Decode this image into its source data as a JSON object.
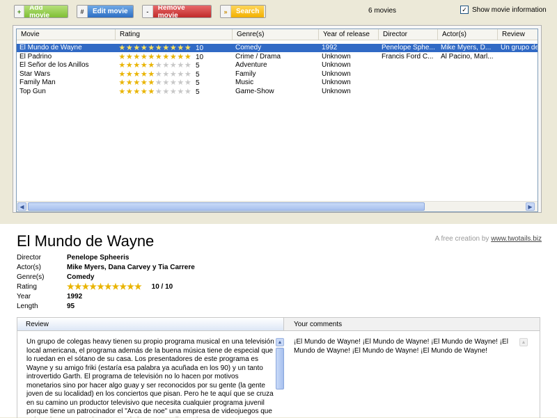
{
  "toolbar": {
    "add": {
      "icon": "+",
      "label": "Add movie"
    },
    "edit": {
      "icon": "#",
      "label": "Edit movie"
    },
    "remove": {
      "icon": "-",
      "label": "Remove movie"
    },
    "search": {
      "icon": "»",
      "label": "Search"
    },
    "movie_count": "6 movies",
    "show_info_label": "Show movie information",
    "show_info_checked": true
  },
  "list": {
    "columns": [
      "Movie",
      "Rating",
      "Genre(s)",
      "Year of release",
      "Director",
      "Actor(s)",
      "Review"
    ],
    "rows": [
      {
        "movie": "El Mundo de Wayne",
        "rating": 10,
        "genre": "Comedy",
        "year": "1992",
        "director": "Penelope Sphe...",
        "actors": "Mike Myers, D...",
        "review": "Un grupo de",
        "selected": true
      },
      {
        "movie": "El Padrino",
        "rating": 10,
        "genre": "Crime / Drama",
        "year": "Unknown",
        "director": "Francis Ford C...",
        "actors": "Al Pacino, Marl...",
        "review": "",
        "selected": false
      },
      {
        "movie": "El Señor de los Anillos",
        "rating": 5,
        "genre": "Adventure",
        "year": "Unknown",
        "director": "",
        "actors": "",
        "review": "",
        "selected": false
      },
      {
        "movie": "Star Wars",
        "rating": 5,
        "genre": "Family",
        "year": "Unknown",
        "director": "",
        "actors": "",
        "review": "",
        "selected": false
      },
      {
        "movie": "Family Man",
        "rating": 5,
        "genre": "Music",
        "year": "Unknown",
        "director": "",
        "actors": "",
        "review": "",
        "selected": false
      },
      {
        "movie": "Top Gun",
        "rating": 5,
        "genre": "Game-Show",
        "year": "Unknown",
        "director": "",
        "actors": "",
        "review": "",
        "selected": false
      }
    ],
    "max_rating": 10
  },
  "details": {
    "title": "El Mundo de Wayne",
    "credit_text": "A free creation by",
    "credit_link": "www.twotails.biz",
    "fields": {
      "director_label": "Director",
      "director": "Penelope Spheeris",
      "actors_label": "Actor(s)",
      "actors": "Mike Myers, Dana Carvey y Tia Carrere",
      "genre_label": "Genre(s)",
      "genre": "Comedy",
      "rating_label": "Rating",
      "rating": 10,
      "rating_text": "10 / 10",
      "year_label": "Year",
      "year": "1992",
      "length_label": "Length",
      "length": "95"
    },
    "review_header": "Review",
    "comments_header": "Your comments",
    "review_text": "Un grupo de colegas heavy tienen su propio programa musical en una televisión local americana, el programa además de la buena música tiene de especial que lo ruedan en el sótano de su casa. Los presentadores de este programa es Wayne y su amigo friki (estaría esa palabra ya acuñada en los 90) y un tanto introvertido Garth. El programa de televisión no lo hacen por motivos monetarios sino por hacer algo guay y ser reconocidos por su gente (la gente joven de su localidad) en los conciertos que pisan. Pero he te aquí que se cruza en su camino un productor televisivo que necesita cualquier programa juvenil porque tiene un patrocinador el \"Arca de noe\" una empresa de videojuegos que quiere dar a conocer los nuevos títulos y ganar dinero, hay que reconocer que vil mente porque no hasan",
    "comments_text": "¡El Mundo de Wayne! ¡El Mundo de Wayne! ¡El Mundo de Wayne! ¡El Mundo de Wayne! ¡El Mundo de Wayne! ¡El Mundo de Wayne!"
  }
}
